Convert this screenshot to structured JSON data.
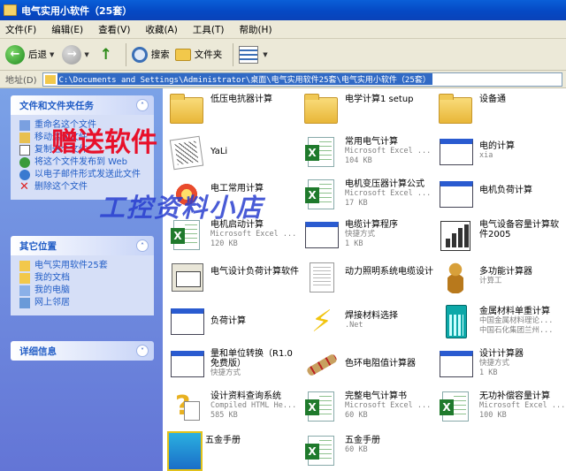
{
  "window": {
    "title": "电气实用小软件（25套）"
  },
  "menu": [
    "文件(F)",
    "编辑(E)",
    "查看(V)",
    "收藏(A)",
    "工具(T)",
    "帮助(H)"
  ],
  "toolbar": {
    "back": "后退",
    "search": "搜索",
    "folders": "文件夹"
  },
  "address": {
    "label": "地址(D)",
    "path": "C:\\Documents and Settings\\Administrator\\桌面\\电气实用软件25套\\电气实用小软件（25套）"
  },
  "side": {
    "tasks": {
      "title": "文件和文件夹任务",
      "links": [
        "重命名这个文件",
        "移动这个文件",
        "复制这个文件",
        "将这个文件发布到 Web",
        "以电子邮件形式发送此文件",
        "删除这个文件"
      ]
    },
    "other": {
      "title": "其它位置",
      "links": [
        "电气实用软件25套",
        "我的文档",
        "我的电脑",
        "网上邻居"
      ]
    },
    "details": {
      "title": "详细信息"
    }
  },
  "items": [
    {
      "name": "低压电抗器计算",
      "sub1": "",
      "sub2": "",
      "icon": "folder"
    },
    {
      "name": "电学计算1 setup",
      "sub1": "",
      "sub2": "",
      "icon": "folder"
    },
    {
      "name": "设备通",
      "sub1": "",
      "sub2": "",
      "icon": "folder"
    },
    {
      "name": "YaLi",
      "sub1": "",
      "sub2": "",
      "icon": "yali"
    },
    {
      "name": "常用电气计算",
      "sub1": "Microsoft Excel ...",
      "sub2": "104 KB",
      "icon": "excel"
    },
    {
      "name": "电的计算",
      "sub1": "xia",
      "sub2": "",
      "icon": "app-window"
    },
    {
      "name": "电工常用计算",
      "sub1": "",
      "sub2": "",
      "icon": "magnet"
    },
    {
      "name": "电机变压器计算公式",
      "sub1": "Microsoft Excel ...",
      "sub2": "17 KB",
      "icon": "excel"
    },
    {
      "name": "电机负荷计算",
      "sub1": "",
      "sub2": "",
      "icon": "app-window"
    },
    {
      "name": "电机启动计算",
      "sub1": "Microsoft Excel ...",
      "sub2": "120 KB",
      "icon": "excel"
    },
    {
      "name": "电缆计算程序",
      "sub1": "快捷方式",
      "sub2": "1 KB",
      "icon": "app-window"
    },
    {
      "name": "电气设备容量计算软件2005",
      "sub1": "",
      "sub2": "",
      "icon": "bar-chart"
    },
    {
      "name": "电气设计负荷计算软件",
      "sub1": "",
      "sub2": "",
      "icon": "cad"
    },
    {
      "name": "动力照明系统电缆设计",
      "sub1": "",
      "sub2": "",
      "icon": "document"
    },
    {
      "name": "多功能计算器",
      "sub1": "计算工",
      "sub2": "",
      "icon": "gourd"
    },
    {
      "name": "负荷计算",
      "sub1": "",
      "sub2": "",
      "icon": "app-window"
    },
    {
      "name": "焊接材料选择",
      "sub1": ".Net",
      "sub2": "",
      "icon": "lightning"
    },
    {
      "name": "金属材料单重计算",
      "sub1": "中国金属材料理论...",
      "sub2": "中国石化集团兰州...",
      "icon": "calculator"
    },
    {
      "name": "量和单位转换（R1.0免费版）",
      "sub1": "快捷方式",
      "sub2": "",
      "icon": "app-window"
    },
    {
      "name": "色环电阻值计算器",
      "sub1": "",
      "sub2": "",
      "icon": "resistor"
    },
    {
      "name": "设计计算器",
      "sub1": "快捷方式",
      "sub2": "1 KB",
      "icon": "app-window"
    },
    {
      "name": "设计资料查询系统",
      "sub1": "Compiled HTML He...",
      "sub2": "585 KB",
      "icon": "help-file"
    },
    {
      "name": "完整电气计算书",
      "sub1": "Microsoft Excel ...",
      "sub2": "60 KB",
      "icon": "excel"
    },
    {
      "name": "无功补偿容量计算",
      "sub1": "Microsoft Excel ...",
      "sub2": "100 KB",
      "icon": "excel"
    },
    {
      "name": "五金手册",
      "sub1": "",
      "sub2": "",
      "icon": "app"
    },
    {
      "name": "五金手册",
      "sub1": "",
      "sub2": "60 KB",
      "icon": "excel"
    }
  ],
  "watermarks": {
    "red": "赠送软件",
    "blue": "工控资料小店"
  }
}
